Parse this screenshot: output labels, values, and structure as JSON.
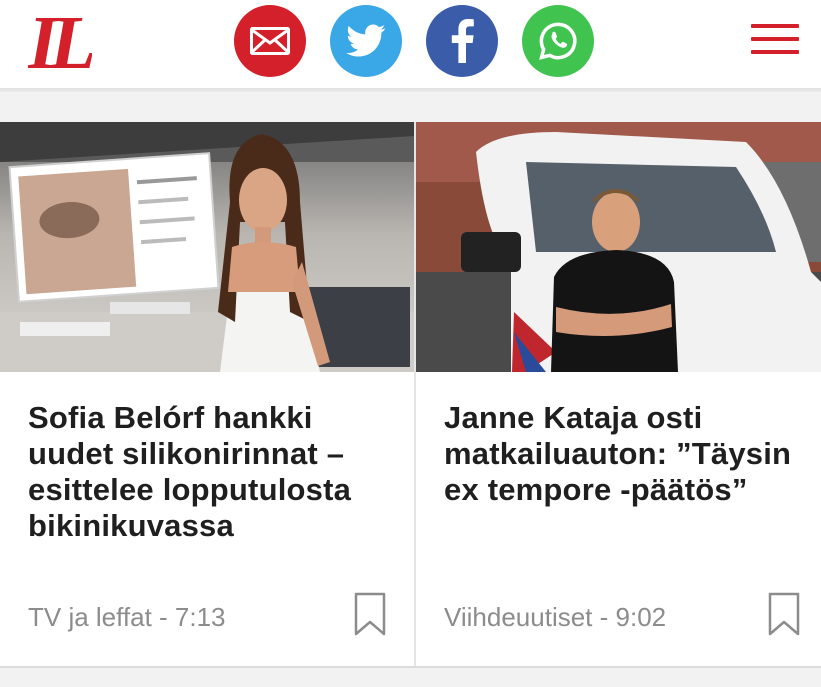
{
  "header": {
    "logo_text": "IL",
    "share": [
      {
        "icon": "mail-icon",
        "color": "#d3202a"
      },
      {
        "icon": "twitter-icon",
        "color": "#3aa7e6"
      },
      {
        "icon": "facebook-icon",
        "color": "#3b5ca8"
      },
      {
        "icon": "whatsapp-icon",
        "color": "#41c350"
      }
    ],
    "menu_icon": "hamburger-menu-icon"
  },
  "cards": [
    {
      "headline": "Sofia Belórf hankki uudet silikonirinnat – esittelee lopputulosta bikinikuvassa",
      "meta": "TV ja leffat - 7:13",
      "image": "photo of woman in white dress next to inset social media post",
      "bookmark_icon": "bookmark-icon"
    },
    {
      "headline": "Janne Kataja osti matkailuauton: ”Täysin ex tempore -päätös”",
      "meta": "Viihdeuutiset - 9:02",
      "image": "photo of man with crossed arms in front of white camper van",
      "bookmark_icon": "bookmark-icon"
    }
  ],
  "colors": {
    "brand_red": "#d3202a",
    "headline": "#1f1f1f",
    "meta": "#8c8c8c"
  }
}
